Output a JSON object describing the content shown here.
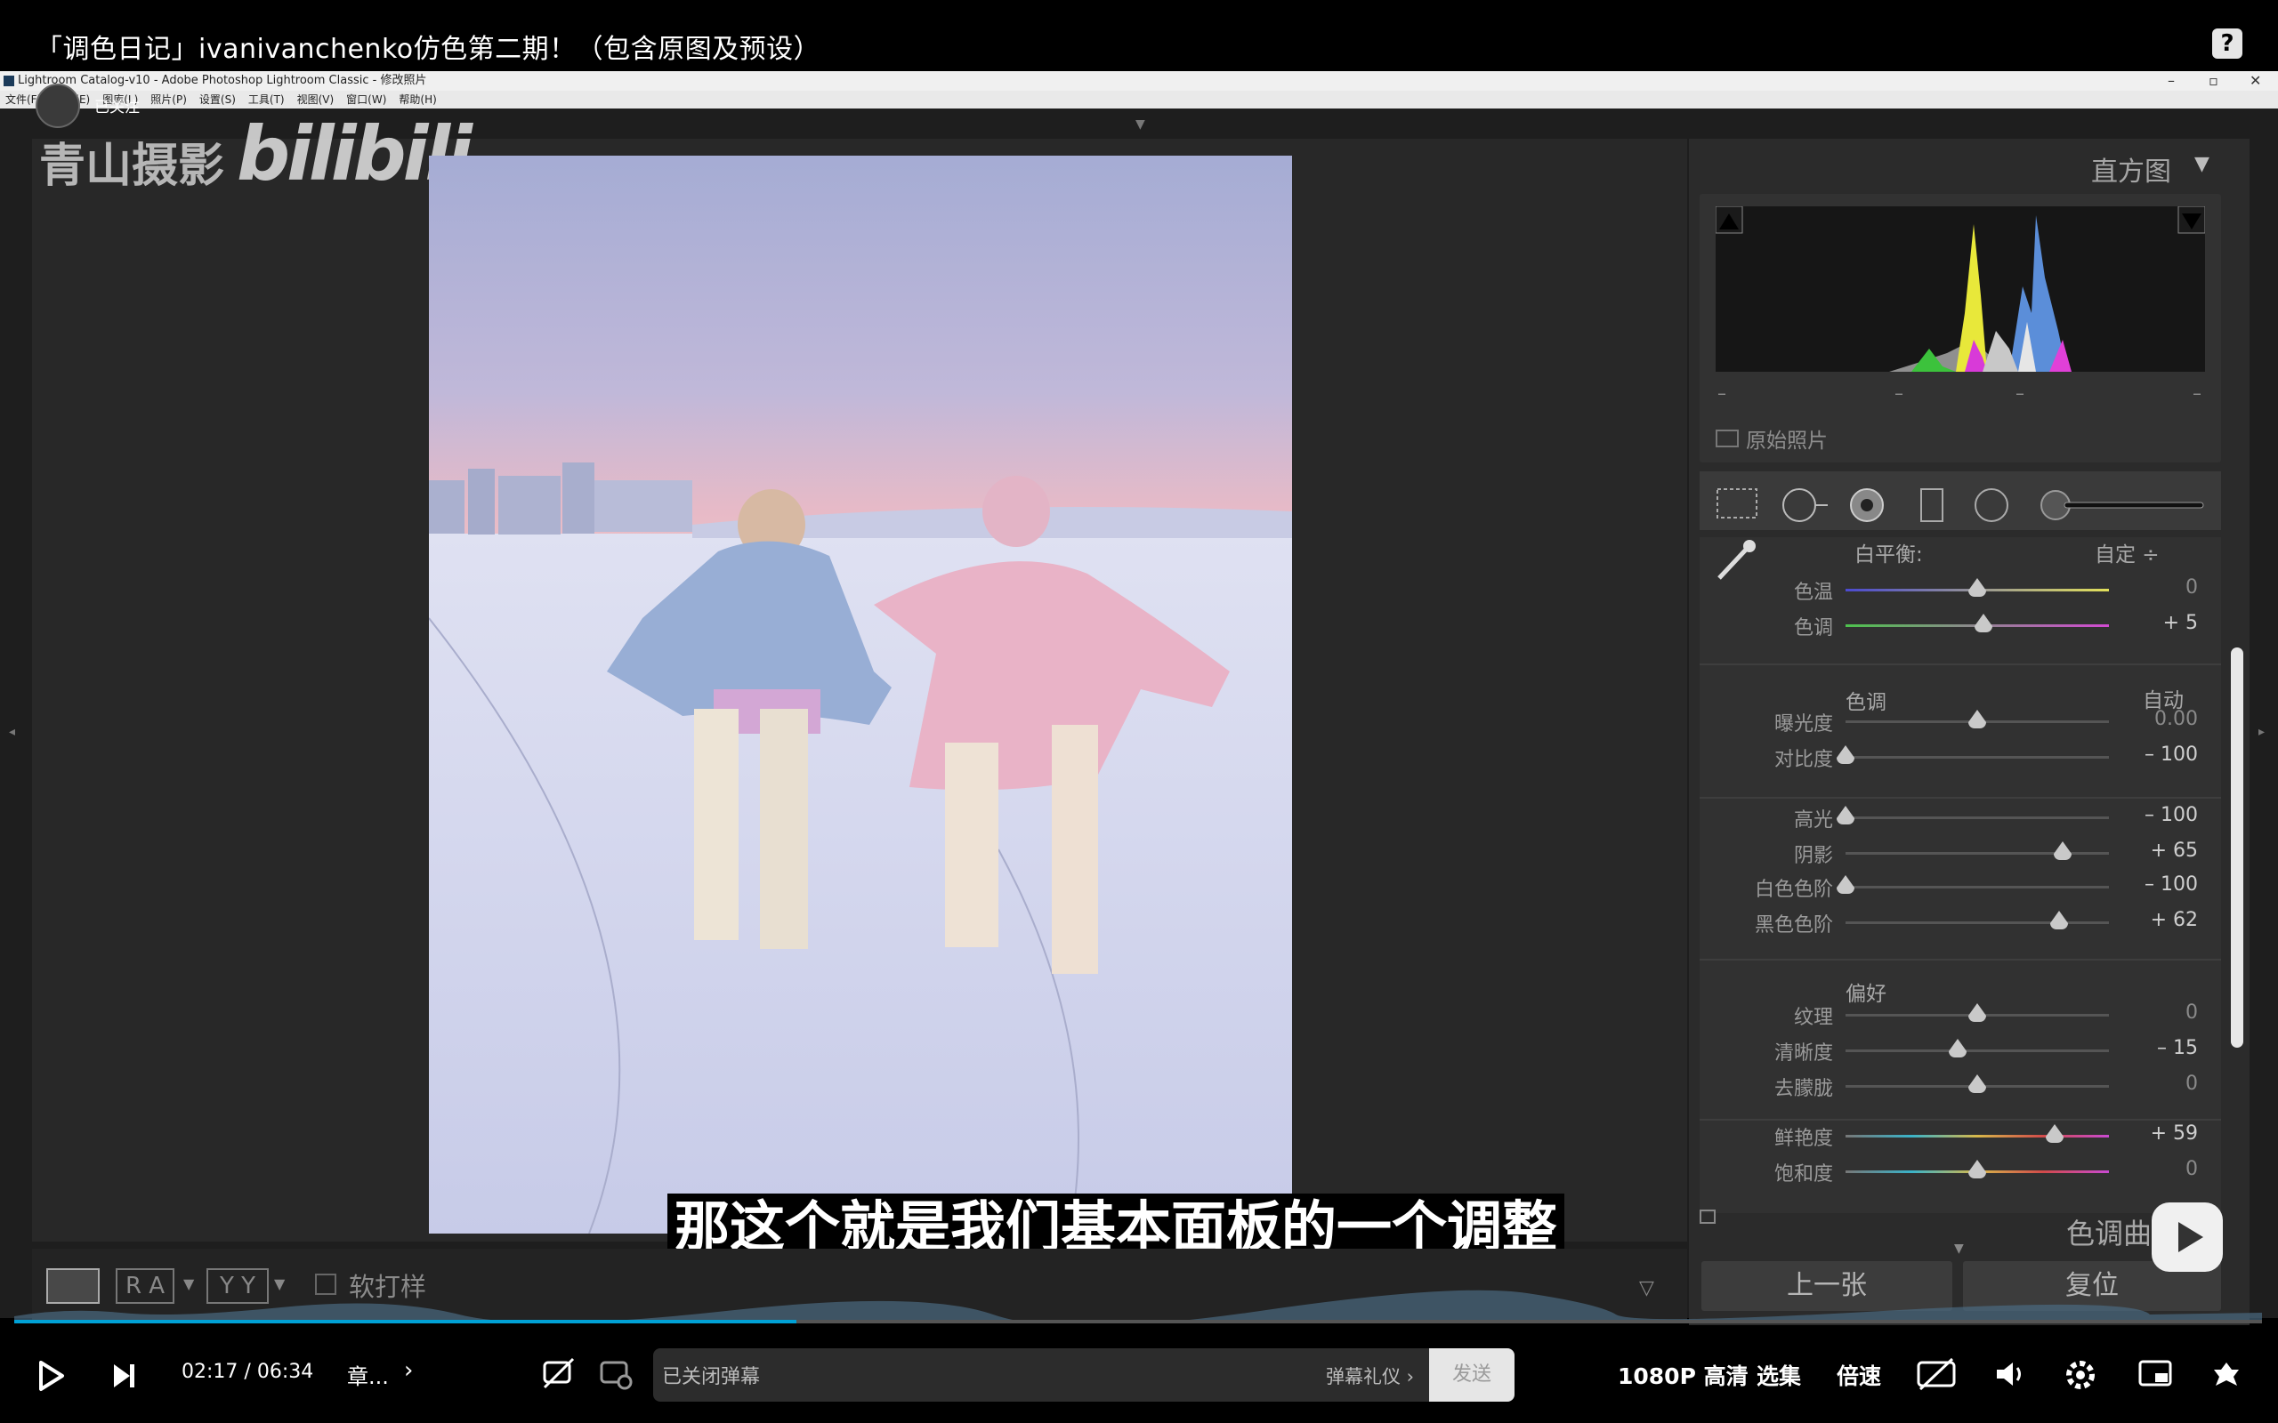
{
  "video_title": "「调色日记」ivanivanchenko仿色第二期！（包含原图及预设）",
  "help_icon": "?",
  "lr_window": {
    "title": "Lightroom Catalog-v10 - Adobe Photoshop Lightroom Classic - 修改照片",
    "menu": [
      "文件(F)",
      "编辑(E)",
      "图库(L)",
      "照片(P)",
      "设置(S)",
      "工具(T)",
      "视图(V)",
      "窗口(W)",
      "帮助(H)"
    ]
  },
  "uploader": {
    "follow_status": "已关注"
  },
  "watermark": {
    "text": "青山摄影",
    "logo": "bilibili"
  },
  "histogram": {
    "title": "直方图",
    "readout": [
      "–",
      "–",
      "–",
      "–"
    ],
    "original_photo_label": "原始照片"
  },
  "basic": {
    "white_balance_label": "白平衡:",
    "white_balance_value": "自定 ÷",
    "sliders_wb": [
      {
        "label": "色温",
        "value": "0",
        "pos": 0.5,
        "grad": "temp"
      },
      {
        "label": "色调",
        "value": "+ 5",
        "pos": 0.525,
        "grad": "tint"
      }
    ],
    "tone_section": "色调",
    "auto_label": "自动",
    "sliders_tone_a": [
      {
        "label": "曝光度",
        "value": "0.00",
        "pos": 0.5
      },
      {
        "label": "对比度",
        "value": "– 100",
        "pos": 0.0
      }
    ],
    "sliders_tone_b": [
      {
        "label": "高光",
        "value": "– 100",
        "pos": 0.0
      },
      {
        "label": "阴影",
        "value": "+ 65",
        "pos": 0.825
      },
      {
        "label": "白色色阶",
        "value": "– 100",
        "pos": 0.0
      },
      {
        "label": "黑色色阶",
        "value": "+ 62",
        "pos": 0.81
      }
    ],
    "presence_section": "偏好",
    "sliders_presence": [
      {
        "label": "纹理",
        "value": "0",
        "pos": 0.5
      },
      {
        "label": "清晰度",
        "value": "– 15",
        "pos": 0.425
      },
      {
        "label": "去朦胧",
        "value": "0",
        "pos": 0.5
      }
    ],
    "sliders_color": [
      {
        "label": "鲜艳度",
        "value": "+ 59",
        "pos": 0.795,
        "grad": "vib"
      },
      {
        "label": "饱和度",
        "value": "0",
        "pos": 0.5,
        "grad": "sat"
      }
    ],
    "tone_curve_label": "色调曲线",
    "prev_button": "上一张",
    "reset_button": "复位"
  },
  "lr_toolbar": {
    "ra": "R A",
    "yy": "Y Y",
    "soft_proof": "软打样"
  },
  "subtitle": "那这个就是我们基本面板的一个调整",
  "player": {
    "time_current": "02:17",
    "time_sep": "/",
    "time_total": "06:34",
    "progress": 0.348,
    "chapter": "章...",
    "danmu_placeholder": "已关闭弹幕",
    "danmu_etiquette": "弹幕礼仪 ›",
    "send": "发送",
    "quality": "1080P 高清",
    "episodes": "选集",
    "speed": "倍速"
  },
  "colors": {
    "accent": "#00a1d6",
    "panel_bg": "#2b2b2b"
  }
}
